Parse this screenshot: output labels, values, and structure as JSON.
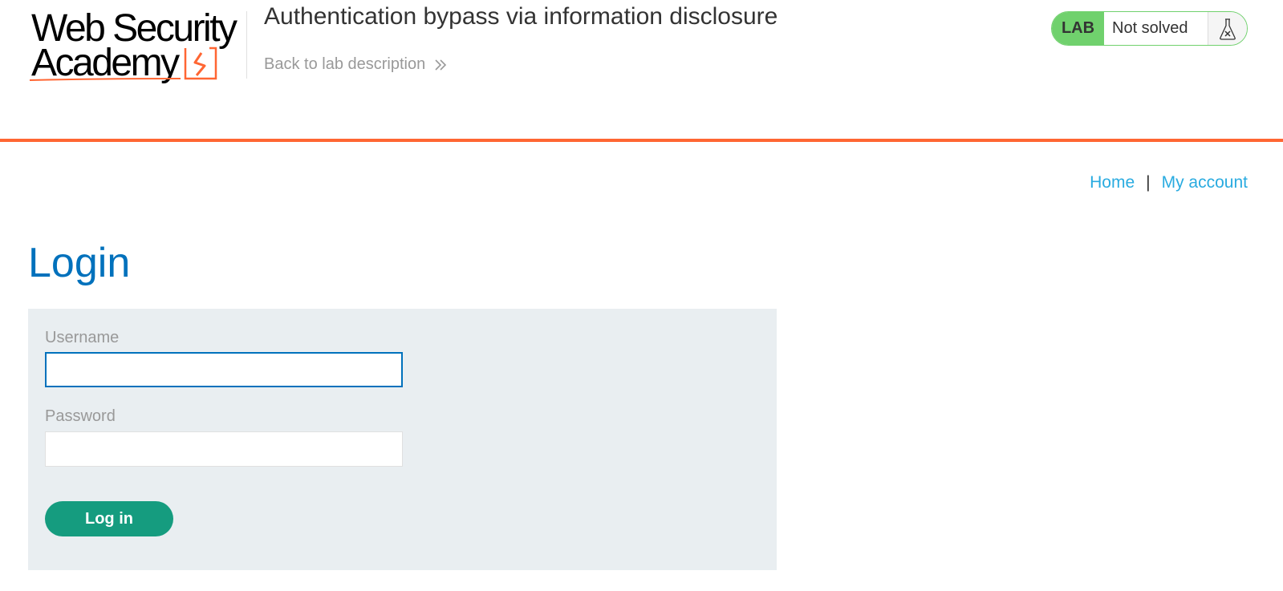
{
  "app": {
    "logo_line1": "Web Security",
    "logo_line2": "Academy"
  },
  "lab": {
    "title": "Authentication bypass via information disclosure",
    "back_link": "Back to lab description",
    "badge": "LAB",
    "status": "Not solved",
    "status_icon": "flask-icon"
  },
  "nav": {
    "home": "Home",
    "separator": "|",
    "my_account": "My account"
  },
  "login": {
    "title": "Login",
    "username_label": "Username",
    "username_value": "",
    "password_label": "Password",
    "password_value": "",
    "submit_label": "Log in"
  },
  "colors": {
    "accent_orange": "#ff6633",
    "title_blue": "#0071bc",
    "link_blue": "#29abe0",
    "status_green": "#70d16d",
    "button_green": "#159c7f",
    "panel_bg": "#e9eef1"
  }
}
